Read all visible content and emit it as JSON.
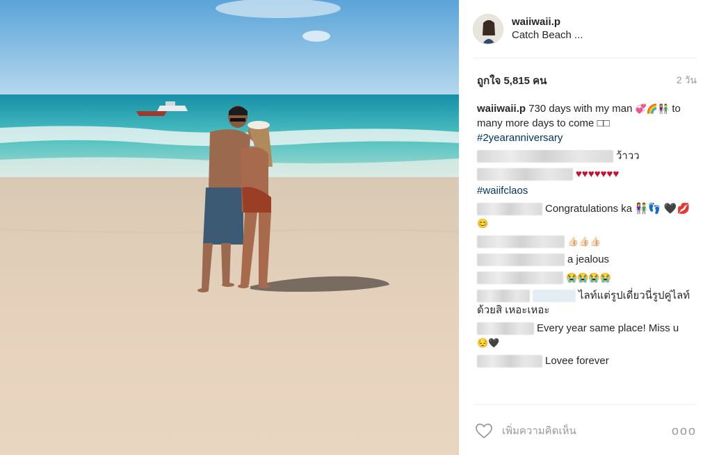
{
  "post": {
    "username": "waiiwaii.p",
    "location": "Catch Beach ...",
    "likes": "ถูกใจ 5,815 คน",
    "time_ago": "2 วัน"
  },
  "caption": {
    "username": "waiiwaii.p",
    "text": "730 days with my man",
    "emoji": "💞🌈👫",
    "text2": " to many more days to come",
    "text3": "□□",
    "hashtag": "#2yearanniversary"
  },
  "comments": [
    {
      "text": "ว้าวว"
    },
    {
      "text": "♥♥♥♥♥♥♥"
    },
    {
      "text": "#waiifclaos"
    },
    {
      "text": "Congratulations ka 👫👣 🖤💋",
      "text2": "😊"
    },
    {
      "text": "👍🏻👍🏻👍🏻"
    },
    {
      "text": "a jealous"
    },
    {
      "text": "😭😭😭😭"
    },
    {
      "text": "ไลท์แต่รูปเดี่ยวนี่รูปคู่ไลท์",
      "text2": "ด้วยสิ เหอะเหอะ"
    },
    {
      "text": "Every year same place! Miss u",
      "text2": "😔🖤"
    },
    {
      "text": "Lovee forever"
    }
  ],
  "footer": {
    "add_comment_placeholder": "เพิ่มความคิดเห็น",
    "more_label": "ooo"
  },
  "colors": {
    "hashtag": "#003569",
    "heart_red": "#c8102e",
    "muted": "#999999"
  },
  "icons": [
    "heart-outline-icon",
    "more-options-icon"
  ]
}
